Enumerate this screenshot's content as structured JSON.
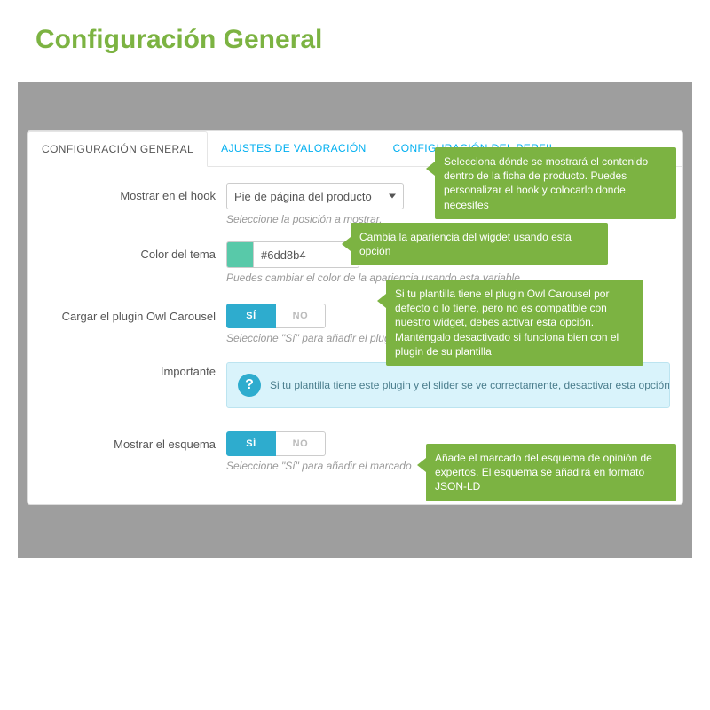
{
  "page_title": "Configuración General",
  "tabs": [
    {
      "label": "CONFIGURACIÓN GENERAL",
      "active": true
    },
    {
      "label": "AJUSTES DE VALORACIÓN",
      "active": false
    },
    {
      "label": "CONFIGURACIÓN DEL PERFIL",
      "active": false
    }
  ],
  "fields": {
    "hook": {
      "label": "Mostrar en el hook",
      "selected": "Pie de página del producto",
      "helper": "Seleccione la posición a mostrar.",
      "callout": "Selecciona dónde se mostrará el contenido dentro de la ficha de producto.  Puedes personalizar el hook y colocarlo donde necesites"
    },
    "theme_color": {
      "label": "Color del tema",
      "value": "#6dd8b4",
      "swatch": "#58c9a9",
      "helper": "Puedes cambiar el color de la apariencia usando esta variable.",
      "callout": "Cambia la apariencia del wigdet usando esta opción"
    },
    "owl": {
      "label": "Cargar el plugin Owl Carousel",
      "yes": "SÍ",
      "no": "NO",
      "value": "SÍ",
      "helper": "Seleccione \"Sí\" para añadir el plugin",
      "callout": "Si tu plantilla tiene el plugin Owl Carousel por defecto o lo tiene, pero no es compatible con nuestro widget, debes activar esta opción. Manténgalo desactivado si funciona bien con el plugin de su plantilla"
    },
    "important": {
      "label": "Importante",
      "text": "Si tu plantilla tiene este plugin y el slider se ve correctamente, desactivar esta opción"
    },
    "schema": {
      "label": "Mostrar el esquema",
      "yes": "SÍ",
      "no": "NO",
      "value": "SÍ",
      "helper": "Seleccione \"Sí\" para añadir el marcado",
      "callout": "Añade el marcado del esquema de opinión de expertos. El esquema se añadirá en formato JSON-LD"
    }
  }
}
